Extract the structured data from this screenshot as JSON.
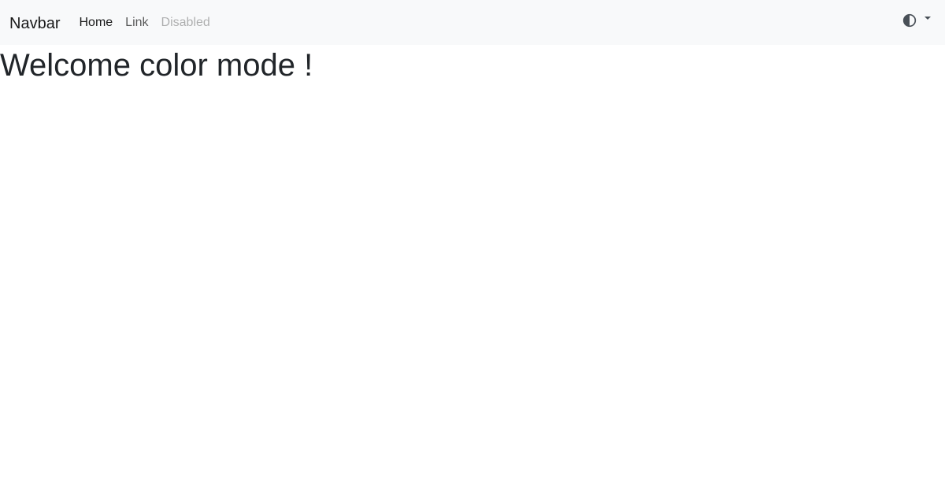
{
  "navbar": {
    "brand": "Navbar",
    "links": [
      {
        "label": "Home",
        "state": "active"
      },
      {
        "label": "Link",
        "state": "normal"
      },
      {
        "label": "Disabled",
        "state": "disabled"
      }
    ],
    "theme_toggle": {
      "icon": "contrast-icon",
      "dropdown_icon": "caret-down-icon"
    }
  },
  "main": {
    "heading": "Welcome color mode !"
  },
  "colors": {
    "navbar_bg": "#f8f9fa",
    "text": "#212529"
  }
}
